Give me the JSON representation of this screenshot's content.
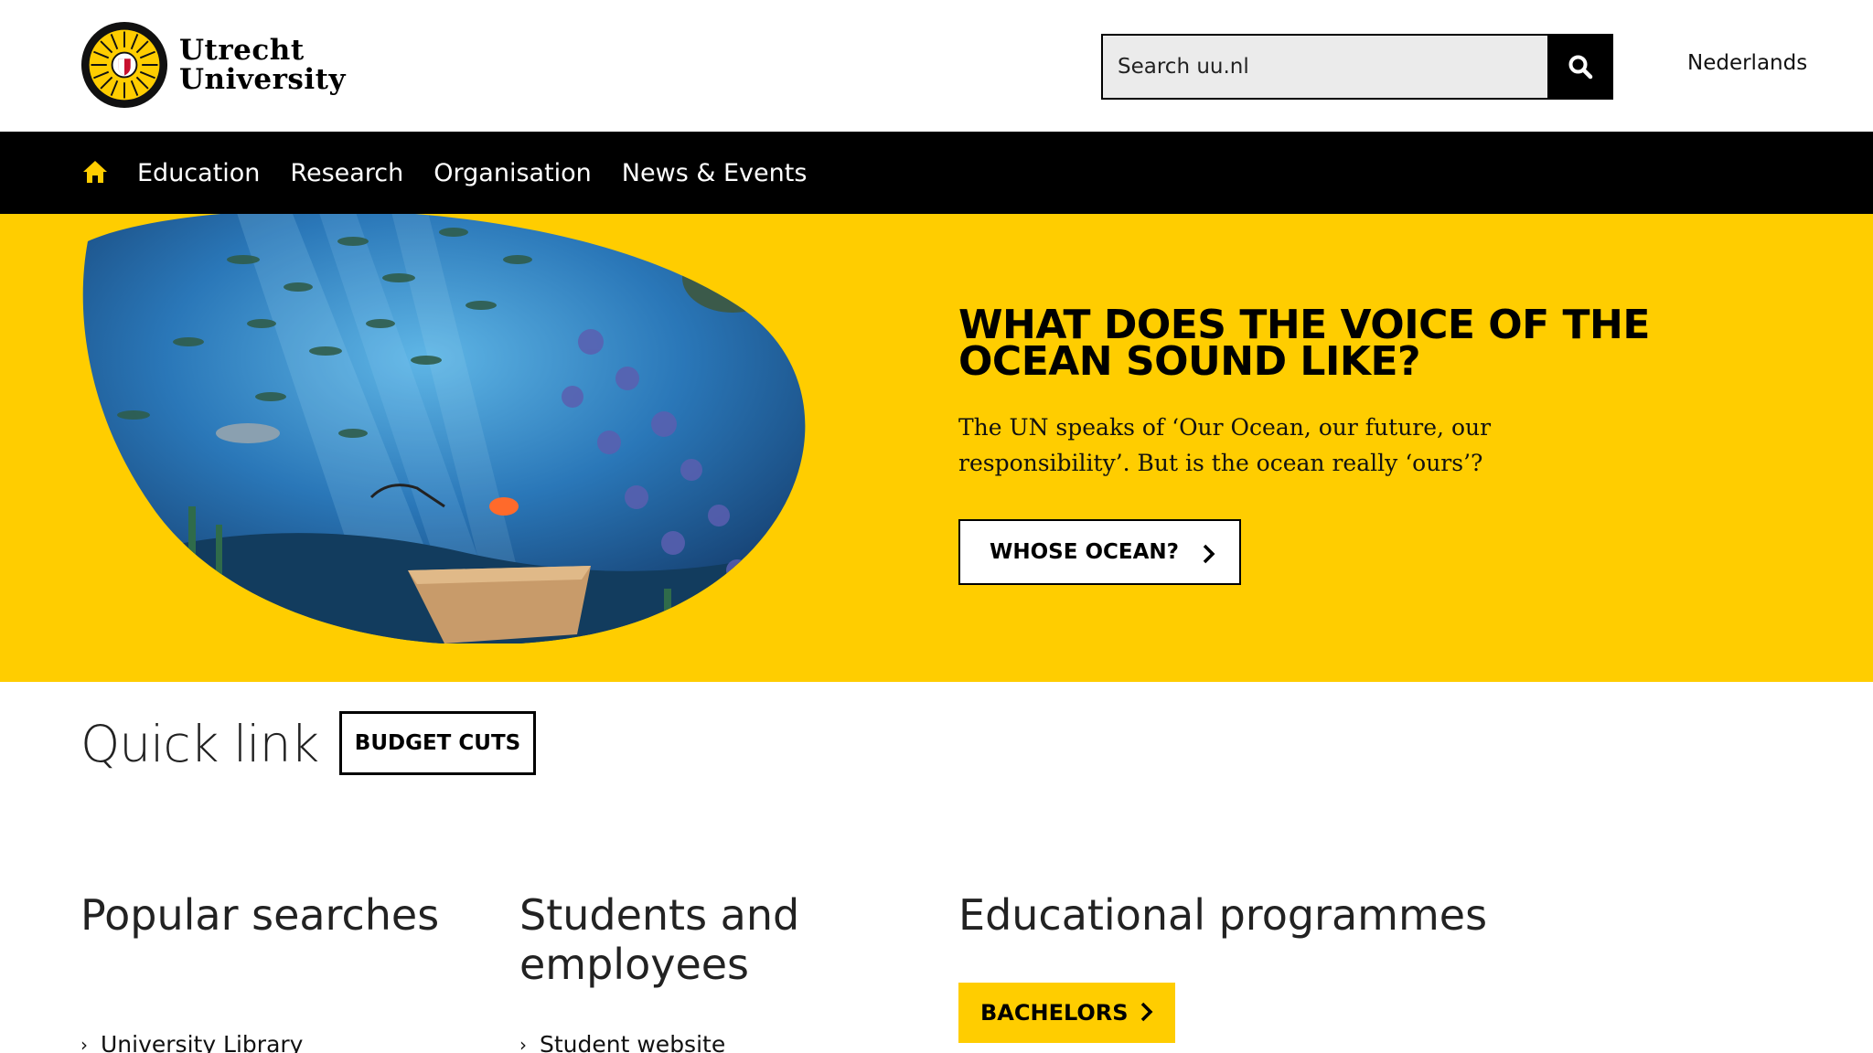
{
  "header": {
    "logo_line1": "Utrecht",
    "logo_line2": "University",
    "search_placeholder": "Search uu.nl",
    "language_link": "Nederlands"
  },
  "nav": {
    "items": [
      {
        "label": "Education"
      },
      {
        "label": "Research"
      },
      {
        "label": "Organisation"
      },
      {
        "label": "News & Events"
      }
    ]
  },
  "hero": {
    "title": "WHAT DOES THE VOICE OF THE OCEAN SOUND LIKE?",
    "text": "The UN speaks of ‘Our Ocean, our future, our responsibility’. But is the ocean really ‘ours’?",
    "button_label": "WHOSE OCEAN?"
  },
  "quick_link": {
    "title": "Quick link",
    "button_label": "BUDGET CUTS"
  },
  "columns": {
    "popular": {
      "title": "Popular searches",
      "items": [
        "University Library"
      ]
    },
    "students": {
      "title": "Students and employees",
      "items": [
        "Student website"
      ]
    },
    "programmes": {
      "title": "Educational programmes",
      "button_label": "BACHELORS"
    }
  },
  "colors": {
    "brand_yellow": "#ffcd00",
    "nav_black": "#000000",
    "search_bg": "#ebebeb"
  },
  "icons": [
    "university-seal-icon",
    "search-icon",
    "home-icon",
    "chevron-right-icon"
  ]
}
